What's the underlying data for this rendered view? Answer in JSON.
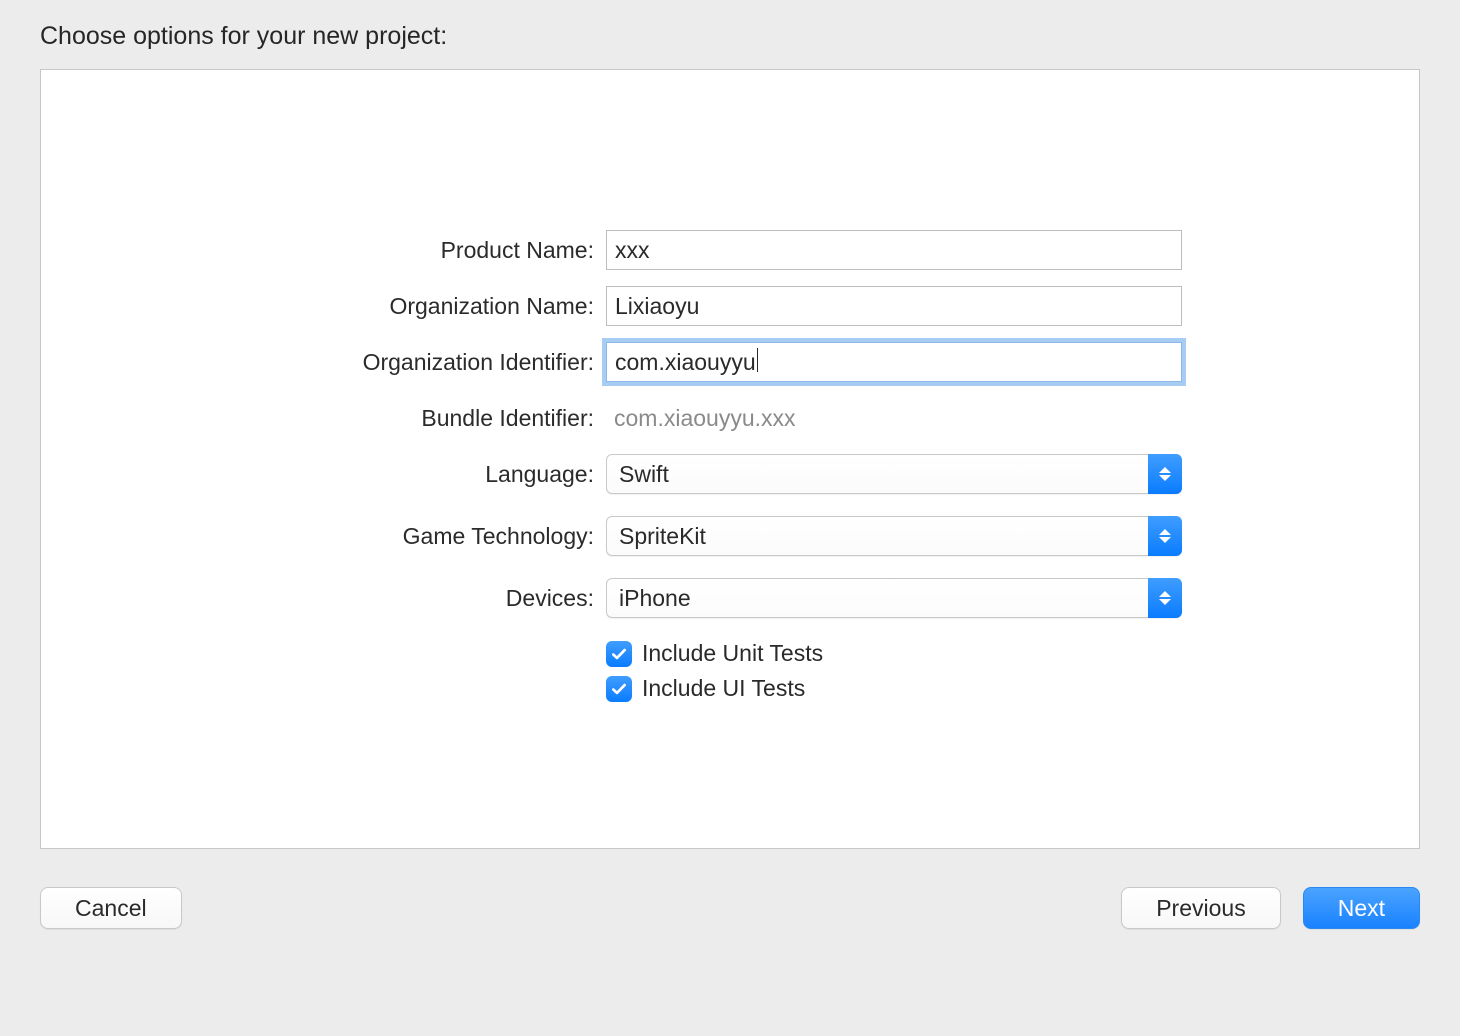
{
  "title": "Choose options for your new project:",
  "labels": {
    "product_name": "Product Name:",
    "organization_name": "Organization Name:",
    "organization_identifier": "Organization Identifier:",
    "bundle_identifier": "Bundle Identifier:",
    "language": "Language:",
    "game_technology": "Game Technology:",
    "devices": "Devices:"
  },
  "values": {
    "product_name": "xxx",
    "organization_name": "Lixiaoyu",
    "organization_identifier": "com.xiaouyyu",
    "bundle_identifier": "com.xiaouyyu.xxx",
    "language": "Swift",
    "game_technology": "SpriteKit",
    "devices": "iPhone"
  },
  "checkboxes": {
    "unit_tests": {
      "label": "Include Unit Tests",
      "checked": true
    },
    "ui_tests": {
      "label": "Include UI Tests",
      "checked": true
    }
  },
  "buttons": {
    "cancel": "Cancel",
    "previous": "Previous",
    "next": "Next"
  }
}
